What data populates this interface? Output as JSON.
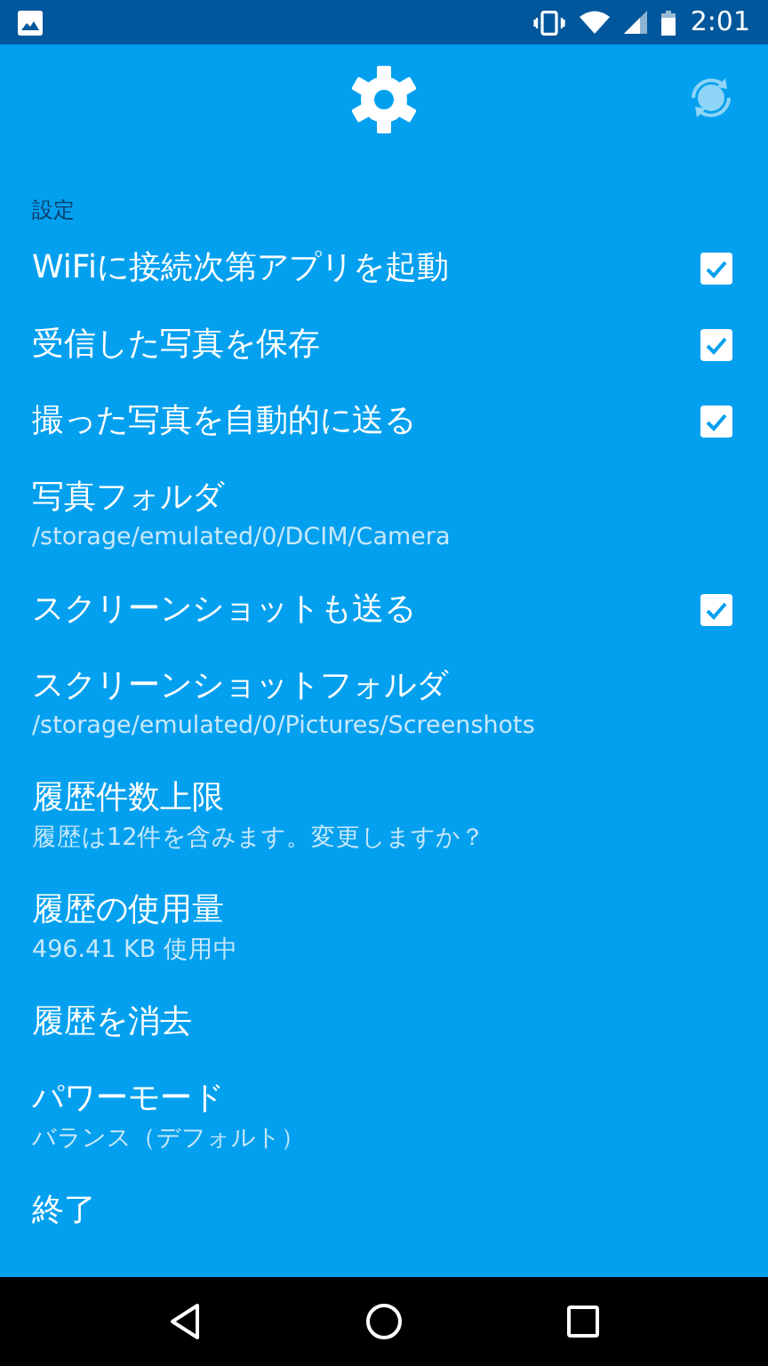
{
  "status_bar": {
    "time": "2:01"
  },
  "section": "設定",
  "settings": [
    {
      "kind": "checkbox",
      "title": "WiFiに接続次第アプリを起動",
      "checked": true
    },
    {
      "kind": "checkbox",
      "title": "受信した写真を保存",
      "checked": true
    },
    {
      "kind": "checkbox",
      "title": "撮った写真を自動的に送る",
      "checked": true
    },
    {
      "kind": "text",
      "title": "写真フォルダ",
      "summary": "/storage/emulated/0/DCIM/Camera"
    },
    {
      "kind": "checkbox",
      "title": "スクリーンショットも送る",
      "checked": true
    },
    {
      "kind": "text",
      "title": "スクリーンショットフォルダ",
      "summary": "/storage/emulated/0/Pictures/Screenshots"
    },
    {
      "kind": "text",
      "title": "履歴件数上限",
      "summary": "履歴は12件を含みます。変更しますか？"
    },
    {
      "kind": "text",
      "title": "履歴の使用量",
      "summary": "496.41 KB 使用中"
    },
    {
      "kind": "text",
      "title": "履歴を消去"
    },
    {
      "kind": "text",
      "title": "パワーモード",
      "summary": "バランス（デフォルト）"
    },
    {
      "kind": "text",
      "title": "終了"
    }
  ]
}
